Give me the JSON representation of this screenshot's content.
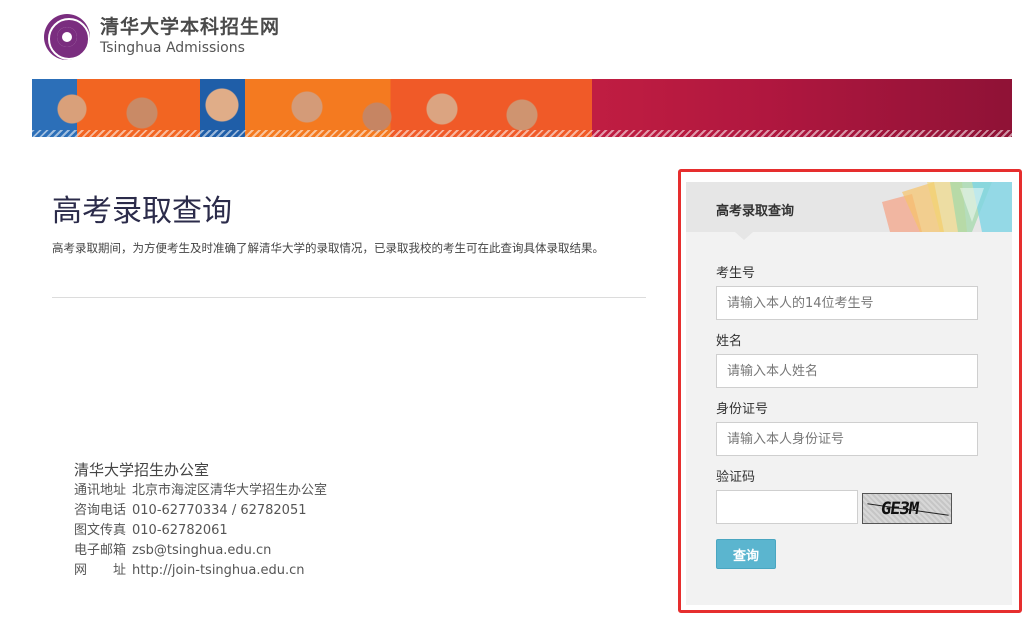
{
  "header": {
    "site_name_cn": "清华大学本科招生网",
    "site_name_en": "Tsinghua Admissions"
  },
  "main": {
    "title": "高考录取查询",
    "intro": "高考录取期间，为方便考生及时准确了解清华大学的录取情况，已录取我校的考生可在此查询具体录取结果。"
  },
  "contact": {
    "office": "清华大学招生办公室",
    "address_label": "通讯地址",
    "address": "北京市海淀区清华大学招生办公室",
    "phone_label": "咨询电话",
    "phone": "010-62770334 / 62782051",
    "fax_label": "图文传真",
    "fax": "010-62782061",
    "email_label": "电子邮箱",
    "email": "zsb@tsinghua.edu.cn",
    "website_label": "网　　址",
    "website": "http://join-tsinghua.edu.cn"
  },
  "query_form": {
    "title": "高考录取查询",
    "exam_no_label": "考生号",
    "exam_no_placeholder": "请输入本人的14位考生号",
    "name_label": "姓名",
    "name_placeholder": "请输入本人姓名",
    "id_label": "身份证号",
    "id_placeholder": "请输入本人身份证号",
    "captcha_label": "验证码",
    "captcha_text": "GE3M",
    "submit_label": "查询"
  },
  "colors": {
    "highlight_border": "#e62e2e",
    "button": "#5bb5cf",
    "brand_purple": "#7a2d7f"
  }
}
